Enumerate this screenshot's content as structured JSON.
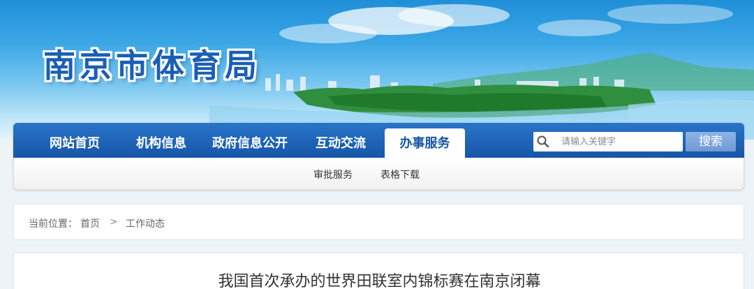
{
  "site": {
    "title": "南京市体育局"
  },
  "nav": {
    "items": [
      {
        "label": "网站首页"
      },
      {
        "label": "机构信息"
      },
      {
        "label": "政府信息公开"
      },
      {
        "label": "互动交流"
      },
      {
        "label": "办事服务",
        "active": true
      }
    ],
    "search": {
      "placeholder": "请输入关键字",
      "button": "搜索"
    },
    "subitems": [
      {
        "label": "审批服务"
      },
      {
        "label": "表格下载"
      }
    ]
  },
  "breadcrumb": {
    "prefix": "当前位置：",
    "home": "首页",
    "separator": ">",
    "current": "工作动态"
  },
  "article": {
    "title": "我国首次承办的世界田联室内锦标赛在南京闭幕"
  },
  "colors": {
    "primary": "#1656a8",
    "nav_gradient_top": "#2a74c8",
    "search_button": "#7aa3da"
  },
  "icons": {
    "search": "search-icon"
  }
}
